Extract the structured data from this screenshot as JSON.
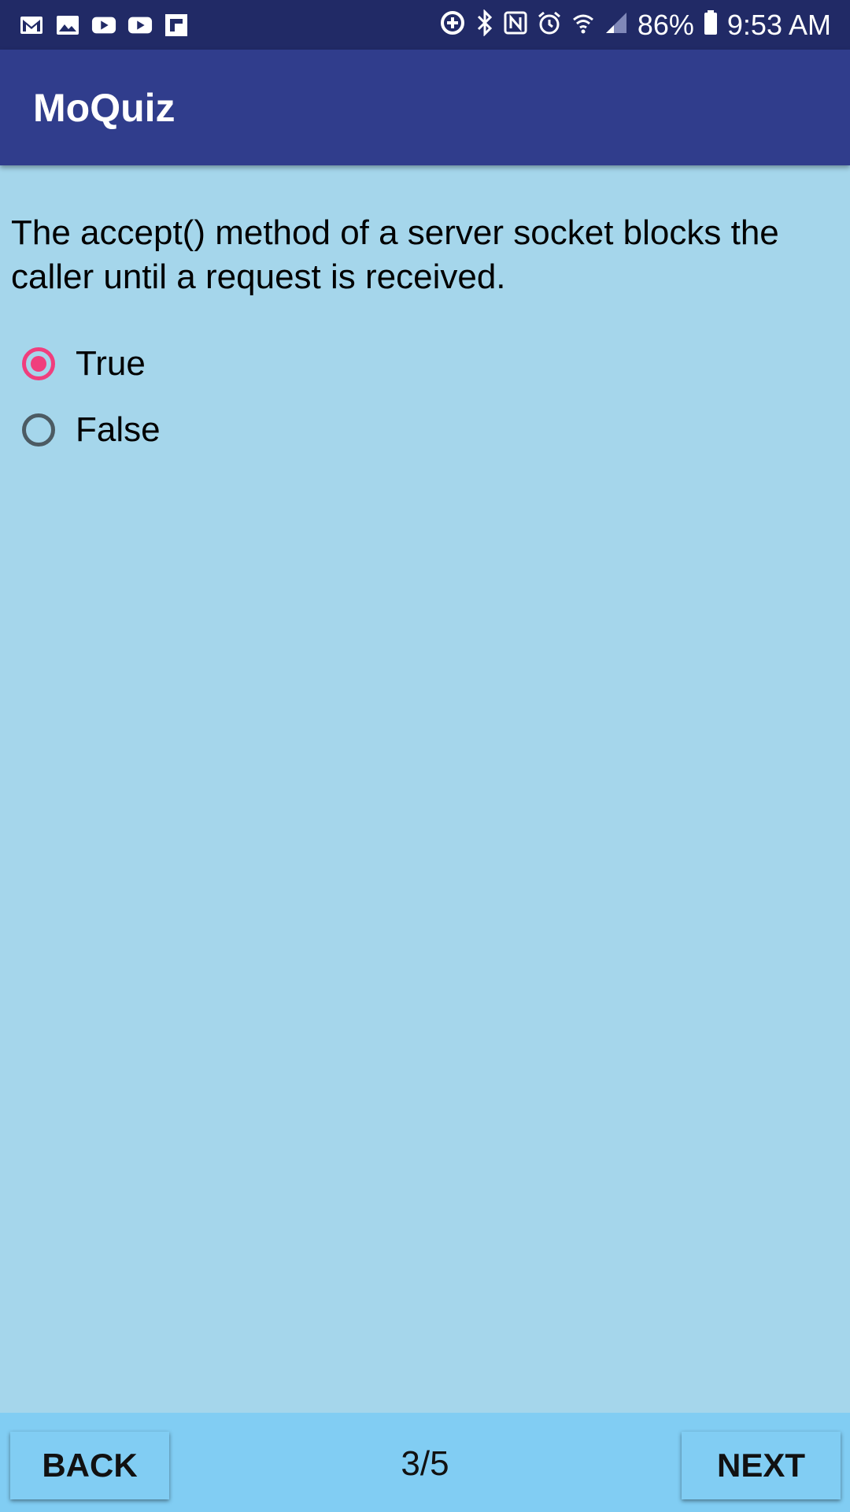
{
  "status_bar": {
    "left_icons": [
      "gmail-icon",
      "gallery-icon",
      "youtube-icon",
      "youtube-icon",
      "flipboard-icon"
    ],
    "right_icons": [
      "data-saver-icon",
      "bluetooth-icon",
      "nfc-icon",
      "alarm-icon",
      "wifi-icon",
      "signal-icon"
    ],
    "battery": "86%",
    "time": "9:53 AM"
  },
  "app": {
    "title": "MoQuiz"
  },
  "question": {
    "text": "The accept() method of a server socket blocks the caller until a request is received.",
    "options": [
      {
        "label": "True",
        "selected": true
      },
      {
        "label": "False",
        "selected": false
      }
    ]
  },
  "navigation": {
    "back_label": "BACK",
    "next_label": "NEXT",
    "progress": "3/5"
  },
  "colors": {
    "status_bar": "#212a66",
    "app_bar": "#303d8c",
    "background": "#a5d6eb",
    "bottom_bar": "#81cdf3",
    "accent": "#f03e7d"
  }
}
